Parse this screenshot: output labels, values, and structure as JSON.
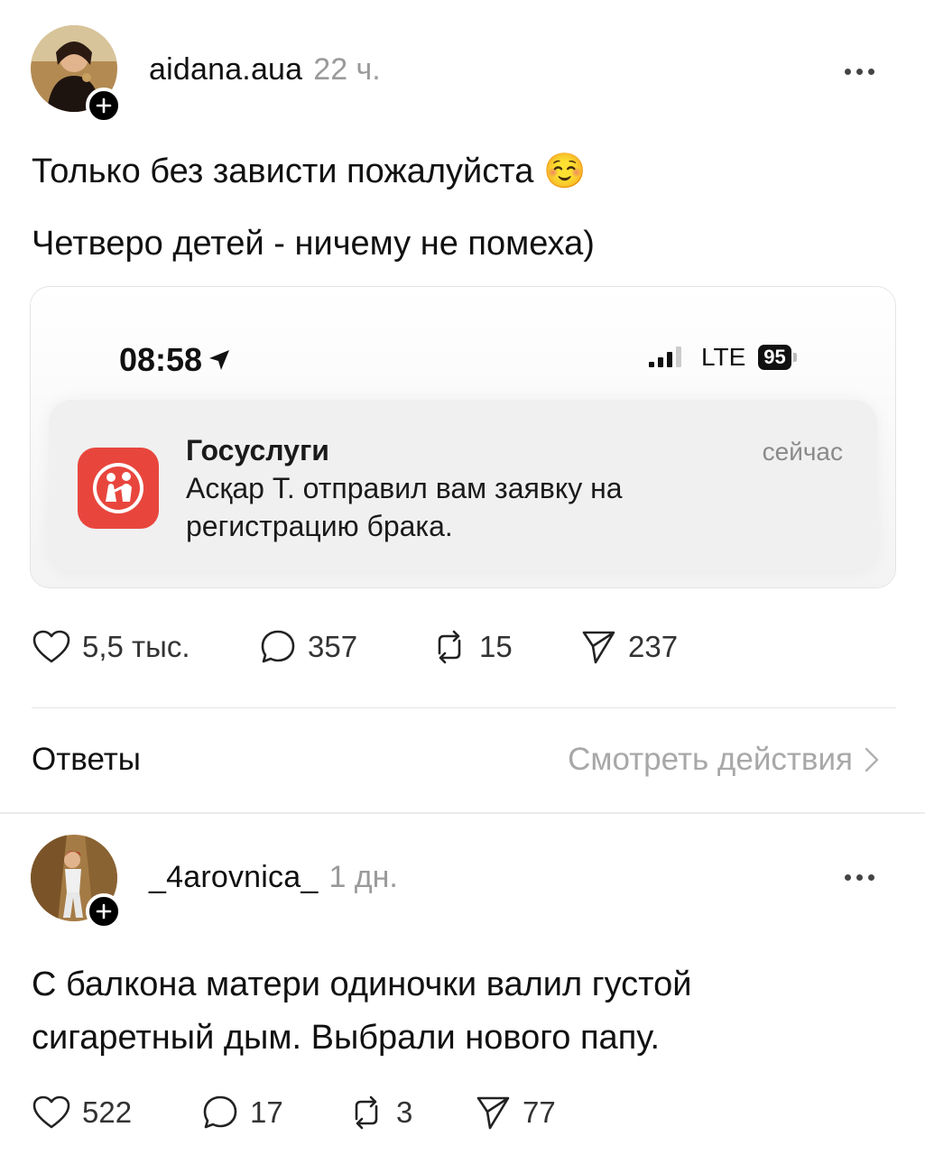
{
  "post1": {
    "username": "aidana.aua",
    "time": "22 ч.",
    "line1": "Только без зависти пожалуйста ☺️",
    "line2": "Четверо детей - ничему не помеха)",
    "embed": {
      "status_time": "08:58",
      "network": "LTE",
      "battery": "95",
      "notification": {
        "app": "Госуслуги",
        "when": "сейчас",
        "body": "Асқар Т. отправил вам заявку на регистрацию брака."
      }
    },
    "stats": {
      "likes": "5,5 тыс.",
      "comments": "357",
      "reposts": "15",
      "shares": "237"
    }
  },
  "replies": {
    "label": "Ответы",
    "view_activity": "Смотреть действия"
  },
  "post2": {
    "username": "_4arovnica_",
    "time": "1 дн.",
    "text": "С балкона матери одиночки валил густой сигаретный дым. Выбрали нового папу.",
    "stats": {
      "likes": "522",
      "comments": "17",
      "reposts": "3",
      "shares": "77"
    }
  },
  "icons": [
    "heart-icon",
    "comment-icon",
    "repost-icon",
    "share-icon",
    "more-icon",
    "plus-icon",
    "location-arrow-icon",
    "signal-icon",
    "gosuslugi-app-icon",
    "chevron-right-icon"
  ]
}
